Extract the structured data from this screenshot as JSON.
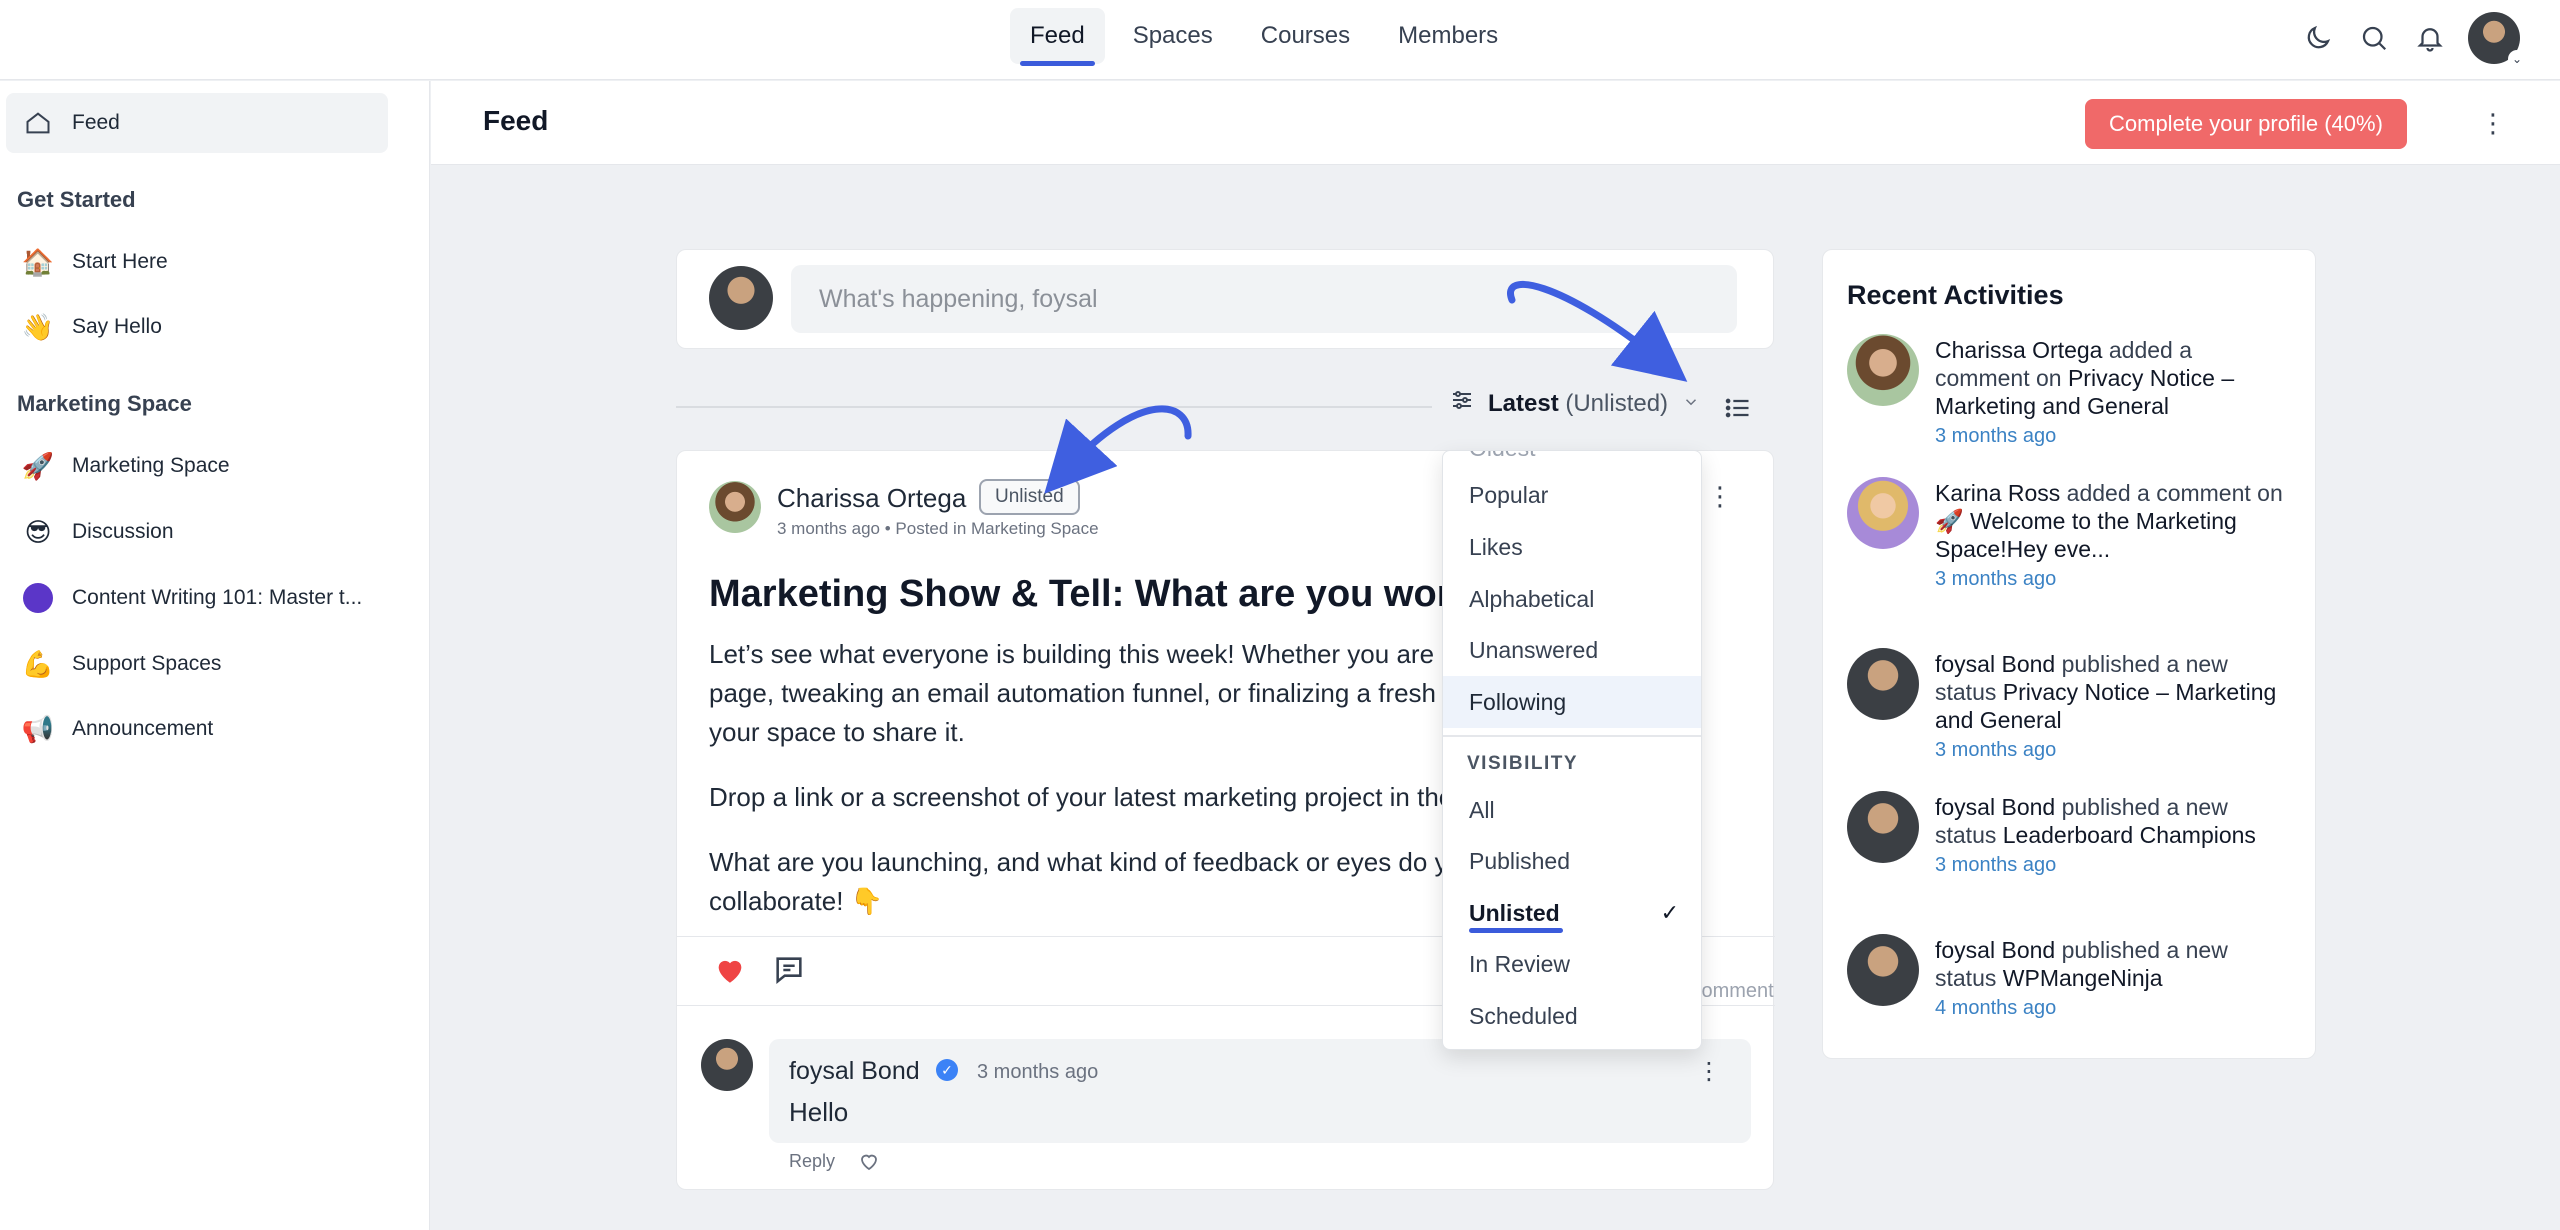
{
  "topnav": {
    "tabs": [
      {
        "label": "Feed",
        "active": true
      },
      {
        "label": "Spaces"
      },
      {
        "label": "Courses"
      },
      {
        "label": "Members"
      }
    ],
    "icons": [
      "moon-icon",
      "search-icon",
      "bell-icon",
      "avatar"
    ]
  },
  "sidebar": {
    "feed_label": "Feed",
    "section1": "Get Started",
    "items1": [
      {
        "emoji": "🏠",
        "label": "Start Here"
      },
      {
        "emoji": "👋",
        "label": "Say Hello"
      }
    ],
    "section2": "Marketing Space",
    "items2": [
      {
        "emoji": "🚀",
        "label": "Marketing Space"
      },
      {
        "emoji": "😎",
        "label": "Discussion"
      },
      {
        "emoji": "",
        "label": "Content Writing 101: Master t..."
      },
      {
        "emoji": "💪",
        "label": "Support Spaces"
      },
      {
        "emoji": "📢",
        "label": "Announcement"
      }
    ]
  },
  "header": {
    "title": "Feed",
    "cta": "Complete your profile (40%)"
  },
  "composer": {
    "placeholder": "What's happening, foysal"
  },
  "sort": {
    "label": "Latest",
    "visibility": "(Unlisted)"
  },
  "dropdown": {
    "partial_top": "Oldest",
    "order_options": [
      "Popular",
      "Likes",
      "Alphabetical",
      "Unanswered",
      "Following"
    ],
    "selected_order": "Following",
    "visibility_heading": "VISIBILITY",
    "visibility_options": [
      "All",
      "Published",
      "Unlisted",
      "In Review",
      "Scheduled"
    ],
    "selected_visibility": "Unlisted",
    "check": "✓"
  },
  "post": {
    "author": "Charissa Ortega",
    "badge": "Unlisted",
    "meta": "3 months ago • Posted in Marketing Space",
    "title": "Marketing Show & Tell: What are you working on?",
    "paragraphs": [
      "Let’s see what everyone is building this week! Whether you are designing a landing",
      "page, tweaking an email automation funnel, or finalizing a fresh ad campaign, this is",
      "your space to share it.",
      "Drop a link or a screenshot of your latest marketing project in the comments below.",
      "What are you launching, and what kind of feedback or eyes do you need? Let’s",
      "collaborate! 👇"
    ],
    "comment_count": "1 Comment"
  },
  "comment": {
    "author": "foysal Bond",
    "time": "3 months ago",
    "text": "Hello",
    "reply": "Reply"
  },
  "activities": {
    "heading": "Recent Activities",
    "items": [
      {
        "who": "Charissa Ortega",
        "action": " added a comment on ",
        "target": "Privacy Notice – Marketing and General",
        "time": "3 months ago"
      },
      {
        "who": "Karina Ross",
        "action": " added a comment on ",
        "target": "🚀 Welcome to the Marketing Space!Hey eve...",
        "time": "3 months ago"
      },
      {
        "who": "foysal Bond",
        "action": " published a new status ",
        "target": "Privacy Notice – Marketing and General",
        "time": "3 months ago"
      },
      {
        "who": "foysal Bond",
        "action": " published a new status ",
        "target": "Leaderboard Champions",
        "time": "3 months ago"
      },
      {
        "who": "foysal Bond",
        "action": " published a new status ",
        "target": "WPMangeNinja",
        "time": "4 months ago"
      }
    ]
  },
  "colors": {
    "accent": "#3b5bdb",
    "cta": "#f06969",
    "link": "#3b82c4",
    "arrow": "#3f5fe0"
  }
}
